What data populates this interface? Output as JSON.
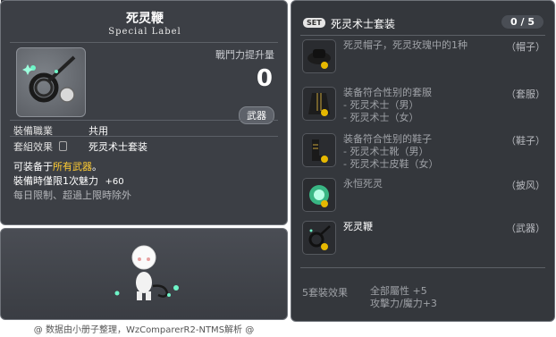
{
  "id_label": "01702876",
  "item": {
    "name": "死灵鞭",
    "subtitle": "Special Label",
    "power_label": "戰鬥力提升量",
    "power_value": "0",
    "category": "武器",
    "job_label": "裝備職業",
    "job_value": "共用",
    "set_label": "套組效果",
    "set_value": "死灵术士套装",
    "equip_prefix": "可装备于",
    "equip_highlight": "所有武器",
    "equip_suffix": "。",
    "charm_text": "裝備時僅限1次魅力",
    "charm_value": "+60",
    "limit_text": "每日限制、超過上限時除外"
  },
  "set": {
    "tag": "SET",
    "name": "死灵术士套装",
    "count": "0 / 5",
    "items": [
      {
        "lines": [
          "死灵帽子，死灵玫瑰中的1种"
        ],
        "type": "（帽子）",
        "icon": "hat-icon",
        "active": false
      },
      {
        "lines": [
          "装备符合性别的套服",
          "- 死灵术士（男）",
          "- 死灵术士（女）"
        ],
        "type": "（套服）",
        "icon": "suit-icon",
        "active": false
      },
      {
        "lines": [
          "装备符合性别的鞋子",
          "- 死灵术士靴（男）",
          "- 死灵术士皮鞋（女）"
        ],
        "type": "（鞋子）",
        "icon": "shoes-icon",
        "active": false
      },
      {
        "lines": [
          "永恒死灵"
        ],
        "type": "（披风）",
        "icon": "cape-icon",
        "active": false
      },
      {
        "lines": [
          "死灵鞭"
        ],
        "type": "（武器）",
        "icon": "whip-icon",
        "active": true
      }
    ],
    "effect_label": "5套裝效果",
    "effect_lines": [
      "全部屬性 +5",
      "攻擊力/魔力+3"
    ]
  },
  "footer": "@ 数据由小册子整理，WzComparerR2-NTMS解析 @",
  "colors": {
    "panel": "#3c3f45",
    "highlight": "#ffcc33",
    "dim": "#9fa2a7"
  }
}
